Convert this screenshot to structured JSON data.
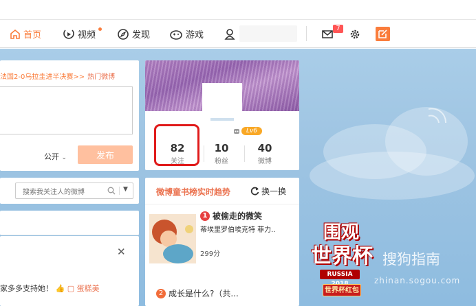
{
  "nav": {
    "home_label": "首页",
    "video_label": "视频",
    "discover_label": "发现",
    "games_label": "游戏",
    "message_count": "7"
  },
  "publisher": {
    "hot_topic": "法国2-0乌拉圭进半决赛>>",
    "hot_topic_tag": "热门微博",
    "visibility": "公开",
    "publish_label": "发布"
  },
  "search": {
    "placeholder": "搜索我关注人的微博"
  },
  "feed": {
    "text": "家多多支持她！",
    "link": "蛋糕美"
  },
  "profile": {
    "level": "Lv6",
    "stats": [
      {
        "value": "82",
        "label": "关注"
      },
      {
        "value": "10",
        "label": "粉丝"
      },
      {
        "value": "40",
        "label": "微博"
      }
    ]
  },
  "trending": {
    "title": "微博童书榜实时趋势",
    "refresh_label": "换一换",
    "items": [
      {
        "rank": "1",
        "title": "被偷走的微笑",
        "desc": "蒂埃里罗伯埃克特 菲力..",
        "score": "299分"
      },
      {
        "rank": "2",
        "title": "成长是什么?（共..."
      }
    ]
  },
  "promo": {
    "line1": "围观",
    "line2": "世界杯",
    "russia": "RUSSIA 2018",
    "redpack": "世界杯红包"
  },
  "watermark": {
    "brand": "搜狗指南",
    "url": "zhinan.sogou.com"
  },
  "colors": {
    "accent": "#fa7d3c",
    "link": "#eb7350",
    "highlight": "#e01b1b"
  }
}
